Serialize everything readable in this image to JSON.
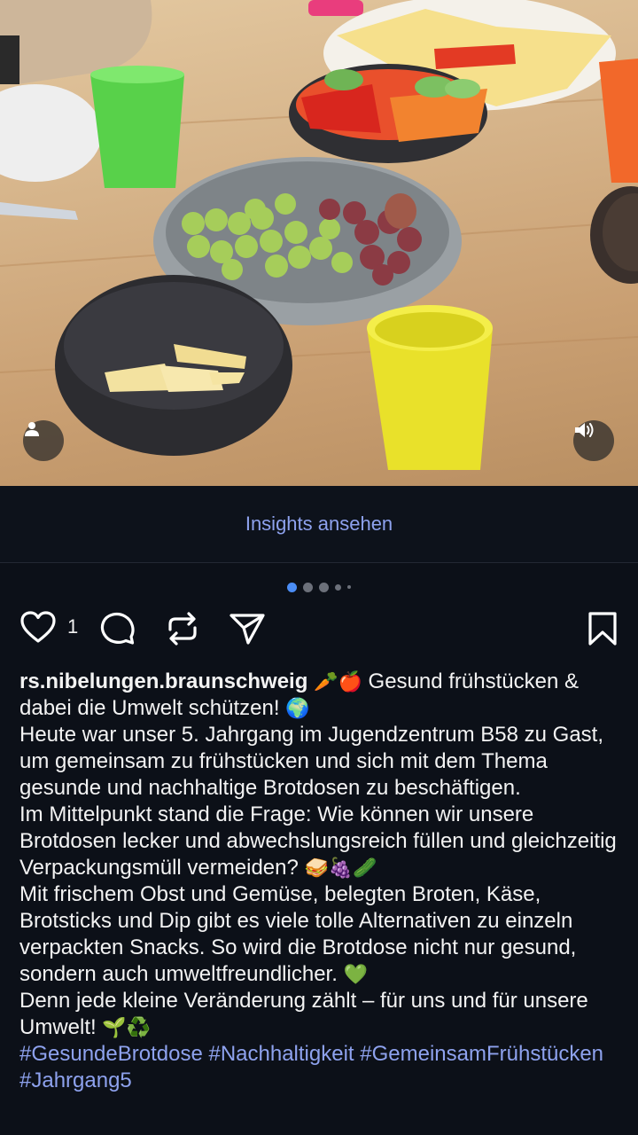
{
  "photo": {
    "tag_icon": "person-tag-icon",
    "sound_icon": "speaker-icon"
  },
  "insights": {
    "label": "Insights ansehen"
  },
  "carousel": {
    "dots": 5,
    "active": 1
  },
  "actions": {
    "like_icon": "heart-icon",
    "like_count": "1",
    "comment_icon": "comment-icon",
    "repost_icon": "repost-icon",
    "share_icon": "send-icon",
    "save_icon": "bookmark-icon"
  },
  "post": {
    "username": "rs.nibelungen.braunschweig",
    "headline_emoji": "🥕🍎",
    "headline": "Gesund frühstücken & dabei die Umwelt schützen!",
    "headline_end_emoji": "🌍",
    "para1": "Heute war unser 5. Jahrgang im Jugendzentrum B58 zu Gast, um gemeinsam zu frühstücken und sich mit dem Thema gesunde und nachhaltige Brotdosen zu beschäftigen.",
    "para2": "Im Mittelpunkt stand die Frage: Wie können wir unsere Brotdosen lecker und abwechslungsreich füllen und gleichzeitig Verpackungsmüll vermeiden?",
    "para2_emoji": "🥪🍇🥒",
    "para3": "Mit frischem Obst und Gemüse, belegten Broten, Käse, Brotsticks und Dip gibt es viele tolle Alternativen zu einzeln verpackten Snacks. So wird die Brotdose nicht nur gesund, sondern auch umweltfreundlicher.",
    "para3_emoji": "💚",
    "para4": "Denn jede kleine Veränderung zählt – für uns und für unsere Umwelt!",
    "para4_emoji": "🌱♻️",
    "hashtags": "#GesundeBrotdose #Nachhaltigkeit #GemeinsamFrühstücken #Jahrgang5"
  },
  "colors": {
    "background": "#0c1018",
    "link": "#8ea2ee",
    "active_dot": "#4b8df5"
  }
}
